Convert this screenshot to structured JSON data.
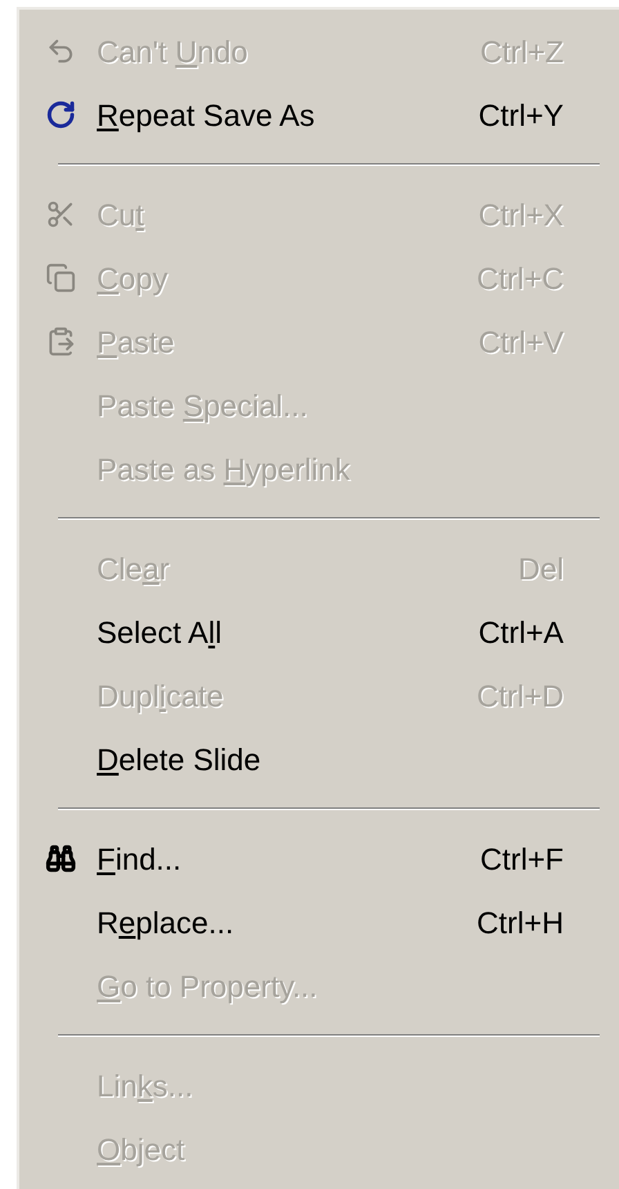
{
  "menu": {
    "items": [
      {
        "kind": "item",
        "before": "Can't ",
        "key": "U",
        "after": "ndo",
        "shortcut": "Ctrl+Z",
        "disabled": true
      },
      {
        "kind": "item",
        "key": "R",
        "after": "epeat Save As",
        "shortcut": "Ctrl+Y",
        "disabled": false
      },
      {
        "kind": "separator"
      },
      {
        "kind": "item",
        "before": "Cu",
        "key": "t",
        "shortcut": "Ctrl+X",
        "disabled": true
      },
      {
        "kind": "item",
        "key": "C",
        "after": "opy",
        "shortcut": "Ctrl+C",
        "disabled": true
      },
      {
        "kind": "item",
        "key": "P",
        "after": "aste",
        "shortcut": "Ctrl+V",
        "disabled": true
      },
      {
        "kind": "item",
        "before": "Paste ",
        "key": "S",
        "after": "pecial...",
        "disabled": true
      },
      {
        "kind": "item",
        "before": "Paste as ",
        "key": "H",
        "after": "yperlink",
        "disabled": true
      },
      {
        "kind": "separator"
      },
      {
        "kind": "item",
        "before": "Cle",
        "key": "a",
        "after": "r",
        "shortcut": "Del",
        "disabled": true
      },
      {
        "kind": "item",
        "before": "Select A",
        "key": "l",
        "after": "l",
        "shortcut": "Ctrl+A",
        "disabled": false
      },
      {
        "kind": "item",
        "before": "Dupl",
        "key": "i",
        "after": "cate",
        "shortcut": "Ctrl+D",
        "disabled": true
      },
      {
        "kind": "item",
        "key": "D",
        "after": "elete Slide",
        "disabled": false
      },
      {
        "kind": "separator"
      },
      {
        "kind": "item",
        "key": "F",
        "after": "ind...",
        "shortcut": "Ctrl+F",
        "disabled": false
      },
      {
        "kind": "item",
        "before": "R",
        "key": "e",
        "after": "place...",
        "shortcut": "Ctrl+H",
        "disabled": false
      },
      {
        "kind": "item",
        "key": "G",
        "after": "o to Property...",
        "disabled": true
      },
      {
        "kind": "separator"
      },
      {
        "kind": "item",
        "before": "Lin",
        "key": "k",
        "after": "s...",
        "disabled": true
      },
      {
        "kind": "item",
        "key": "O",
        "after": "bject",
        "disabled": true
      }
    ]
  }
}
